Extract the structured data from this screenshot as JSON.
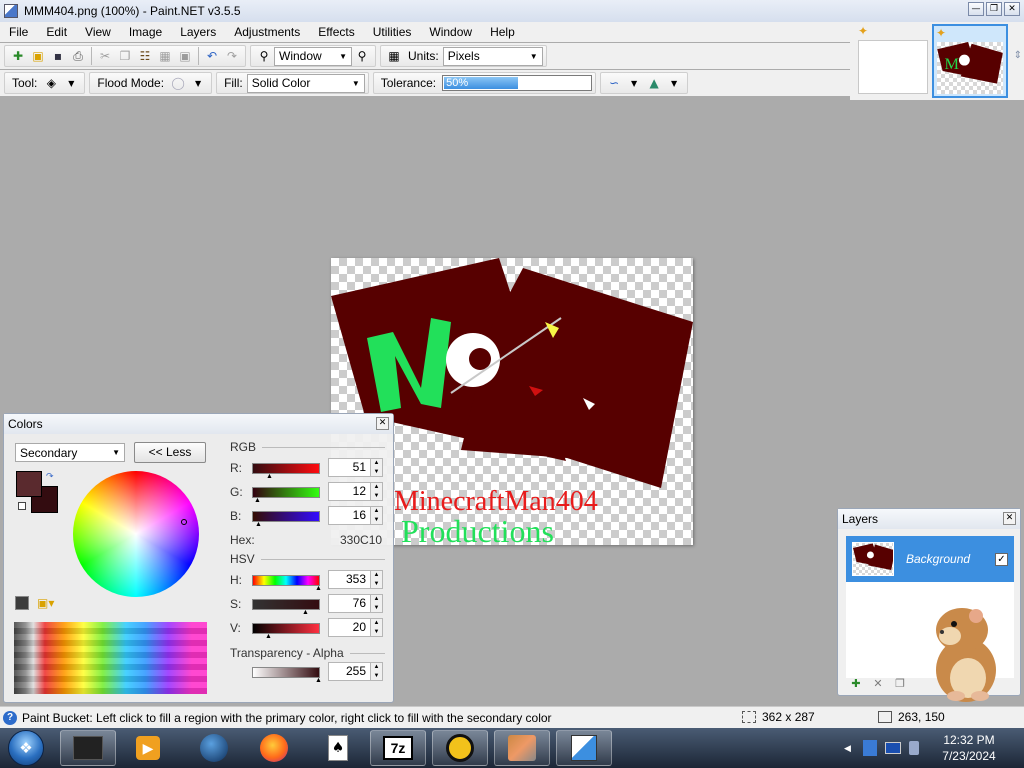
{
  "window": {
    "title": "MMM404.png (100%) - Paint.NET v3.5.5",
    "min_btn": "0",
    "max_btn": "1",
    "close_btn": "r"
  },
  "menu": [
    "File",
    "Edit",
    "View",
    "Image",
    "Layers",
    "Adjustments",
    "Effects",
    "Utilities",
    "Window",
    "Help"
  ],
  "toolbar": {
    "zoom_value": "Window",
    "units_label": "Units:",
    "units_value": "Pixels"
  },
  "toolbar2": {
    "tool_label": "Tool:",
    "flood_mode_label": "Flood Mode:",
    "fill_label": "Fill:",
    "fill_value": "Solid Color",
    "tolerance_label": "Tolerance:",
    "tolerance_text": "50%",
    "tolerance_fraction": 0.5
  },
  "image": {
    "line1": "MinecraftMan404",
    "line2": "Productions"
  },
  "colors_panel": {
    "title": "Colors",
    "mode_value": "Secondary",
    "less_button": "<< Less",
    "primary_color": "#5a2a2e",
    "secondary_color": "#33 0C10",
    "rgb_header": "RGB",
    "r_label": "R:",
    "r_value": "51",
    "g_label": "G:",
    "g_value": "12",
    "b_label": "B:",
    "b_value": "16",
    "hex_label": "Hex:",
    "hex_value": "330C10",
    "hsv_header": "HSV",
    "h_label": "H:",
    "h_value": "353",
    "s_label": "S:",
    "s_value": "76",
    "v_label": "V:",
    "v_value": "20",
    "alpha_header": "Transparency - Alpha",
    "alpha_value": "255"
  },
  "layers_panel": {
    "title": "Layers",
    "layer_name": "Background"
  },
  "status": {
    "message": "Paint Bucket: Left click to fill a region with the primary color, right click to fill with the secondary color",
    "image_size": "362 x 287",
    "cursor_pos": "263, 150"
  },
  "taskbar": {
    "time": "12:32 PM",
    "date": "7/23/2024"
  },
  "accent": "#3c8fe0"
}
